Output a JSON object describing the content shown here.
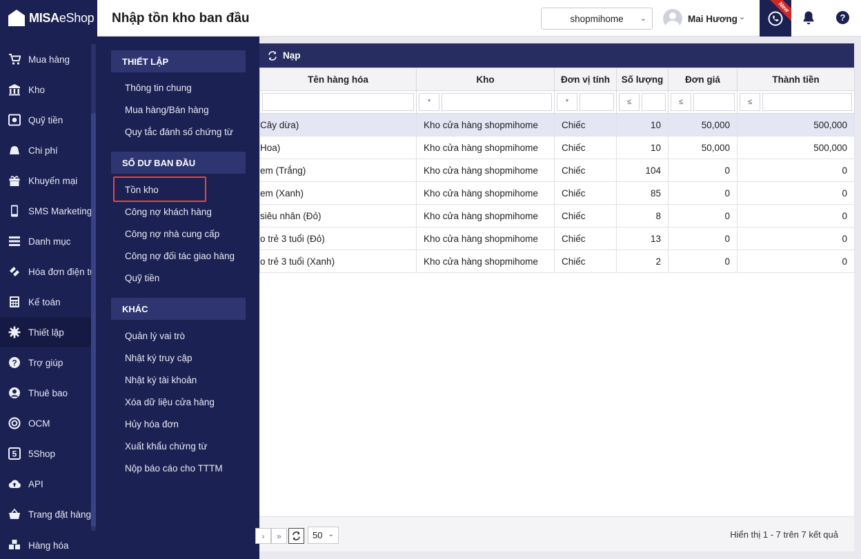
{
  "app": {
    "logo_text": "MISA",
    "logo_text2": "eShop"
  },
  "header": {
    "title": "Nhập tồn kho ban đầu",
    "shop": "shopmihome",
    "user": "Mai Hương",
    "new_badge": "New"
  },
  "sidebar": {
    "items": [
      {
        "label": "Mua hàng",
        "icon": "cart-icon"
      },
      {
        "label": "Kho",
        "icon": "warehouse-icon"
      },
      {
        "label": "Quỹ tiền",
        "icon": "safe-icon"
      },
      {
        "label": "Chi phí",
        "icon": "expense-icon"
      },
      {
        "label": "Khuyến mại",
        "icon": "gift-icon"
      },
      {
        "label": "SMS Marketing",
        "icon": "phone-icon"
      },
      {
        "label": "Danh mục",
        "icon": "list-icon"
      },
      {
        "label": "Hóa đơn điện tử",
        "icon": "invoice-icon"
      },
      {
        "label": "Kế toán",
        "icon": "calculator-icon"
      },
      {
        "label": "Thiết lập",
        "icon": "gear-icon"
      },
      {
        "label": "Trợ giúp",
        "icon": "help-icon"
      },
      {
        "label": "Thuê bao",
        "icon": "user-icon"
      },
      {
        "label": "OCM",
        "icon": "ocm-icon"
      },
      {
        "label": "5Shop",
        "icon": "5shop-icon"
      },
      {
        "label": "API",
        "icon": "cloud-upload-icon"
      },
      {
        "label": "Trang đặt hàng",
        "icon": "basket-icon"
      },
      {
        "label": "Hàng hóa",
        "icon": "goods-icon"
      }
    ]
  },
  "flyout": {
    "groups": [
      {
        "title": "THIẾT LẬP",
        "items": [
          "Thông tin chung",
          "Mua hàng/Bán hàng",
          "Quy tắc đánh số chứng từ"
        ]
      },
      {
        "title": "SỐ DƯ BAN ĐẦU",
        "items": [
          "Tồn kho",
          "Công nợ khách hàng",
          "Công nợ nhà cung cấp",
          "Công nợ đối tác giao hàng",
          "Quỹ tiền"
        ]
      },
      {
        "title": "KHÁC",
        "items": [
          "Quản lý vai trò",
          "Nhật ký truy cập",
          "Nhật ký tài khoản",
          "Xóa dữ liệu cửa hàng",
          "Hủy hóa đơn",
          "Xuất khẩu chứng từ",
          "Nộp báo cáo cho TTTM"
        ]
      }
    ]
  },
  "toolbar": {
    "reload_label": "Nạp"
  },
  "table": {
    "columns": [
      "Tên hàng hóa",
      "Kho",
      "Đơn vị tính",
      "Số lượng",
      "Đơn giá",
      "Thành tiền"
    ],
    "filter_ops": [
      "*",
      "*",
      "≤",
      "≤",
      "≤"
    ],
    "rows": [
      [
        "Cây dừa)",
        "Kho cửa hàng shopmihome",
        "Chiếc",
        "10",
        "50,000",
        "500,000"
      ],
      [
        "Hoa)",
        "Kho cửa hàng shopmihome",
        "Chiếc",
        "10",
        "50,000",
        "500,000"
      ],
      [
        " em (Trắng)",
        "Kho cửa hàng shopmihome",
        "Chiếc",
        "104",
        "0",
        "0"
      ],
      [
        " em (Xanh)",
        "Kho cửa hàng shopmihome",
        "Chiếc",
        "85",
        "0",
        "0"
      ],
      [
        " siêu nhân (Đỏ)",
        "Kho cửa hàng shopmihome",
        "Chiếc",
        "8",
        "0",
        "0"
      ],
      [
        "o trẻ 3 tuổi (Đỏ)",
        "Kho cửa hàng shopmihome",
        "Chiếc",
        "13",
        "0",
        "0"
      ],
      [
        "o trẻ 3 tuổi (Xanh)",
        "Kho cửa hàng shopmihome",
        "Chiếc",
        "2",
        "0",
        "0"
      ]
    ]
  },
  "pager": {
    "page_size": "50",
    "info": "Hiển thị 1 - 7 trên 7 kết quả"
  },
  "colors": {
    "sidebar": "#1b2152",
    "accent_highlight": "#e5483d",
    "toolbar": "#272d61"
  }
}
